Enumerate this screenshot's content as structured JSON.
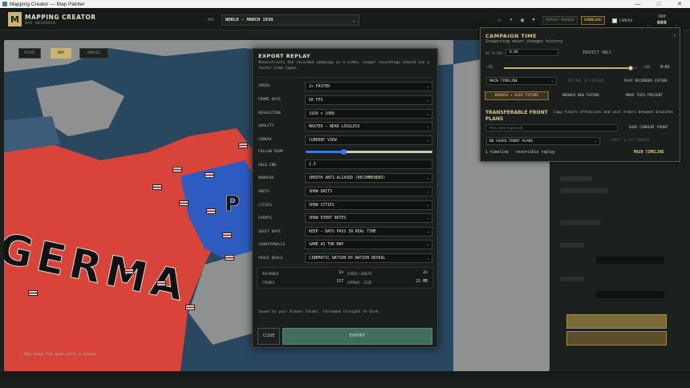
{
  "window": {
    "title": "Mapping Creator — Map Painter",
    "minimize": "—",
    "maximize": "□",
    "close": "✕"
  },
  "brand": {
    "logo_letter": "M",
    "title": "MAPPING CREATOR",
    "subtitle": "WAR OBSERVER"
  },
  "map_select": {
    "label": "MAP",
    "value": "WORLD - MARCH 1936"
  },
  "toolbar": {
    "play": "▷",
    "pause": "⏸",
    "stop": "■",
    "record": "⏺",
    "replay_label": "REPLAY PAUSED",
    "download_label": "DOWNLOAD",
    "camera_label": "CAMERA",
    "day_label": "DAY",
    "day_value": "000",
    "prev": "‹",
    "next": "›"
  },
  "map": {
    "country_label": "GERMA",
    "blue_label": "P",
    "tools": [
      "PAINT",
      "MAP",
      "ARMIES"
    ],
    "hint": "← Map shows the game until a change",
    "colors": {
      "germany": "#d9443a",
      "poland": "#2e5bbf",
      "sea": "#2a4760",
      "land_gray": "#8f9190"
    }
  },
  "campaign": {
    "title": "CAMPAIGN TIME",
    "subtitle": "Inspecting never changes history",
    "close": "✕",
    "go_to_day_label": "GO TO DAY",
    "go_to_day_value": "0.84",
    "inspect_only": "INSPECT ONLY",
    "slider_min": "−55",
    "slider_max": "+55",
    "slider_value": "0:01",
    "slider_fraction": 0.95,
    "timeline_select": "MAIN TIMELINE",
    "return_present": "RETURN TO PRESENT",
    "play_recorded": "PLAY RECORDED FUTURE",
    "branch_keep": "BRANCH + KEEP FUTURE",
    "branch_new": "BRANCH NEW FUTURE",
    "make_present": "MAKE THIS PRESENT",
    "tf_title": "TRANSFERABLE FRONT PLANS",
    "tf_desc": "Copy future offensives and unit orders between branches",
    "plan_placeholder": "Plan name (optional)",
    "save_front": "SAVE CURRENT FRONT",
    "no_saved": "NO SAVED FRONT PLANS",
    "apply_fit": "APPLY & FIT ORDERS",
    "timeline_info": "1 timeline · reversible replay",
    "main_timeline": "MAIN TIMELINE"
  },
  "export": {
    "title": "EXPORT REPLAY",
    "description": "Reconstructs the recorded campaign as a video. Longer recordings should use a faster time-lapse.",
    "fields": [
      {
        "label": "SPEED",
        "value": "2× FASTER"
      },
      {
        "label": "FRAME RATE",
        "value": "60 FPS"
      },
      {
        "label": "RESOLUTION",
        "value": "1920 × 1080"
      },
      {
        "label": "QUALITY",
        "value": "MASTER — NEAR LOSSLESS"
      },
      {
        "label": "CAMERA",
        "value": "CURRENT VIEW"
      }
    ],
    "follow_zoom_label": "FOLLOW ZOOM",
    "follow_zoom_fraction": 0.3,
    "hold_end_label": "HOLD END",
    "hold_end_value": "1.5",
    "fields2": [
      {
        "label": "BORDERS",
        "value": "SMOOTH ANTI-ALIASED (RECOMMENDED)"
      },
      {
        "label": "UNITS",
        "value": "SHOW UNITS"
      },
      {
        "label": "CITIES",
        "value": "SHOW CITIES"
      },
      {
        "label": "EVENTS",
        "value": "SHOW EVENT NOTES"
      },
      {
        "label": "QUIET DAYS",
        "value": "KEEP — DAYS PASS IN REAL TIME"
      },
      {
        "label": "COUNTRYBALLS",
        "value": "SAME AS THE MAP"
      },
      {
        "label": "PEACE DEALS",
        "value": "CINEMATIC NATION-BY-NATION REVEAL"
      }
    ],
    "stats": {
      "recorded_label": "RECORDED",
      "recorded_value": "1s",
      "video_length_label": "VIDEO LENGTH",
      "video_length_value": "2s",
      "frames_label": "FRAMES",
      "frames_value": "117",
      "approx_size_label": "APPROX. SIZE",
      "approx_size_value": "21 MB"
    },
    "saved_note": "Saved to your Videos folder, streamed straight to disk.",
    "close_label": "CLOSE",
    "export_label": "EXPORT"
  }
}
